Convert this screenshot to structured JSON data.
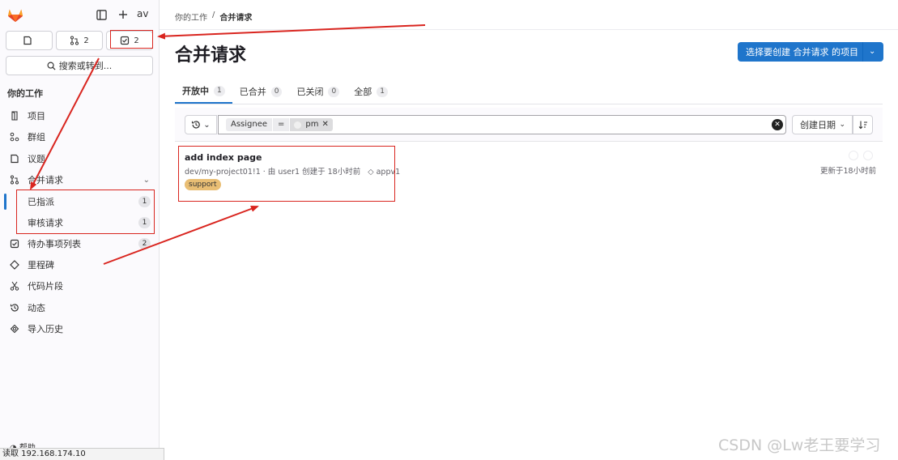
{
  "sidebar": {
    "avatar_text": "av",
    "counts": {
      "issues": "",
      "merge_requests": "2",
      "todos": "2"
    },
    "search_label": "搜索或转到...",
    "section_title": "你的工作",
    "items": [
      {
        "label": "项目",
        "icon": "project-icon"
      },
      {
        "label": "群组",
        "icon": "group-icon"
      },
      {
        "label": "议题",
        "icon": "issues-icon"
      },
      {
        "label": "合并请求",
        "icon": "merge-request-icon",
        "expanded": true
      },
      {
        "label": "已指派",
        "badge": "1",
        "active": true
      },
      {
        "label": "审核请求",
        "badge": "1"
      },
      {
        "label": "待办事项列表",
        "icon": "todo-icon",
        "badge": "2"
      },
      {
        "label": "里程碑",
        "icon": "milestone-icon"
      },
      {
        "label": "代码片段",
        "icon": "snippet-icon"
      },
      {
        "label": "动态",
        "icon": "activity-icon"
      },
      {
        "label": "导入历史",
        "icon": "import-icon"
      }
    ],
    "help_label": "帮助"
  },
  "statusbar": {
    "text": "读取 192.168.174.10"
  },
  "breadcrumb": {
    "parent": "你的工作",
    "separator": "/",
    "current": "合并请求"
  },
  "page": {
    "title": "合并请求",
    "primary_button": "选择要创建 合并请求 的项目"
  },
  "tabs": [
    {
      "label": "开放中",
      "count": "1",
      "active": true
    },
    {
      "label": "已合并",
      "count": "0"
    },
    {
      "label": "已关闭",
      "count": "0"
    },
    {
      "label": "全部",
      "count": "1"
    }
  ],
  "filter": {
    "token_field": "Assignee",
    "token_operator": "=",
    "token_value": "pm",
    "sort_label": "创建日期"
  },
  "merge_requests": [
    {
      "title": "add index page",
      "meta": "dev/my-project01!1 · 由 user1 创建于 18小时前",
      "milestone": "appv1",
      "label": "support",
      "updated": "更新于18小时前"
    }
  ],
  "watermark": "CSDN @Lw老王要学习",
  "colors": {
    "accent": "#1f75cb",
    "annotation_red": "#d9251f",
    "label_support": "#e9be74"
  }
}
